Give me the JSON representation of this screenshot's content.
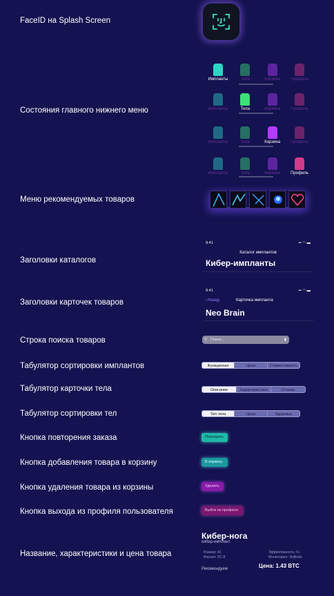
{
  "labels": {
    "faceid": "FaceID на Splash Screen",
    "nav_states": "Состояния главного нижнего меню",
    "recommended": "Меню рекомендуемых товаров",
    "catalog_headers": "Заголовки каталогов",
    "card_headers": "Заголовки карточек товаров",
    "search": "Строка поиска товаров",
    "implant_sort_tabs": "Табулятор сортировки имплантов",
    "body_card_tabs": "Табулятор карточки тела",
    "body_sort_tabs": "Табулятор сортировки тел",
    "repeat_order": "Кнопка повторения заказа",
    "add_to_cart": "Кнопка добавления товара в корзину",
    "remove_from_cart": "Кнопка удаления товара из корзины",
    "logout": "Кнопка выхода из профиля пользователя",
    "product_info": "Название, характеристики и цена товара"
  },
  "nav": {
    "items": [
      "Импланты",
      "Тела",
      "Корзина",
      "Профиль"
    ],
    "colors": [
      "#2fd4c4",
      "#3ee07a",
      "#b43cff",
      "#d23a8c"
    ]
  },
  "catalog_header": {
    "time": "9:41",
    "small_title": "Каталог имплантов",
    "big_title": "Кибер-импланты"
  },
  "card_header": {
    "time": "9:41",
    "back": "Назад",
    "small_title": "Карточка импланта",
    "big_title": "Neo Brain"
  },
  "search": {
    "placeholder": "Поиск..."
  },
  "tabs_implants": [
    "Функционал",
    "Цена",
    "Совместимость"
  ],
  "tabs_body_card": [
    "Описание",
    "Характеристики",
    "Отзывы"
  ],
  "tabs_body_sort": [
    "Тип тела",
    "Цена",
    "Здоровье"
  ],
  "buttons": {
    "repeat": "Повторить",
    "add": "В корзину",
    "remove": "Удалить",
    "logout": "Выйти из профиля"
  },
  "product": {
    "name": "Кибер-нога",
    "subtitle": "кибер-имплант",
    "size": "Размер: 42",
    "version": "Версия: DC-8",
    "efficiency": "Эффективность: 5+",
    "monitoring": "Мониторинг: NuBrain",
    "recommend": "Рекомендуем",
    "price": "Цена: 1.43 BTC"
  }
}
